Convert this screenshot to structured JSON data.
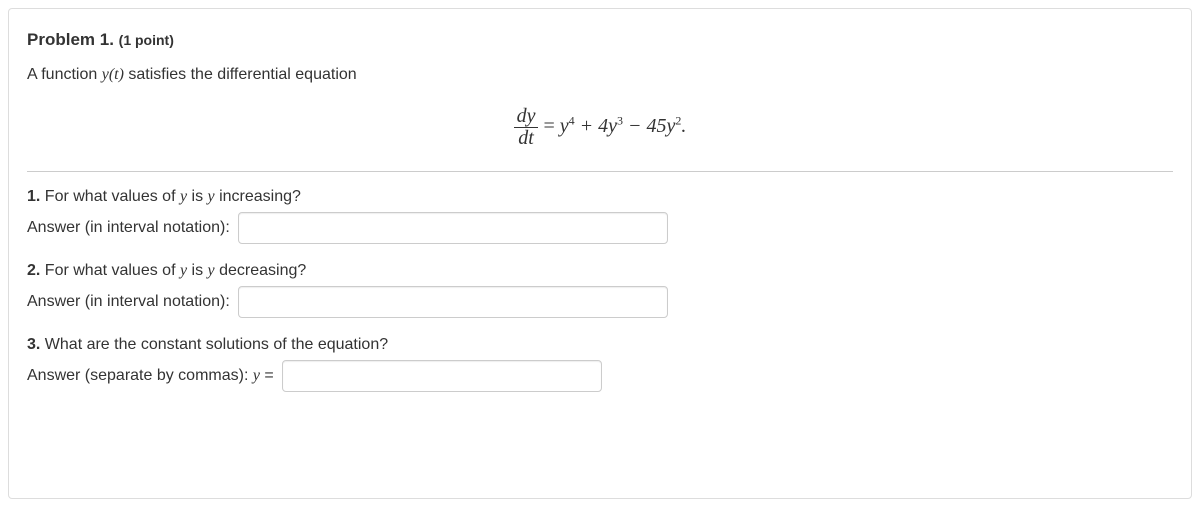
{
  "heading": {
    "label": "Problem 1.",
    "points": "(1 point)"
  },
  "intro": {
    "prefix": "A function ",
    "func": "y(t)",
    "suffix": " satisfies the differential equation"
  },
  "equation": {
    "frac_num": "dy",
    "frac_den": "dt",
    "eq": " = ",
    "rhs_html": "y<sup>4</sup> + 4y<sup>3</sup> − 45y<sup>2</sup>."
  },
  "q1": {
    "num": "1.",
    "text_before": " For what values of ",
    "var1": "y",
    "mid": " is ",
    "var2": "y",
    "text_after": " increasing?",
    "answer_label": "Answer (in interval notation): "
  },
  "q2": {
    "num": "2.",
    "text_before": " For what values of ",
    "var1": "y",
    "mid": " is ",
    "var2": "y",
    "text_after": " decreasing?",
    "answer_label": "Answer (in interval notation): "
  },
  "q3": {
    "num": "3.",
    "text": " What are the constant solutions of the equation?",
    "answer_label_before": "Answer (separate by commas): ",
    "answer_var": "y",
    "answer_eq": " = "
  }
}
